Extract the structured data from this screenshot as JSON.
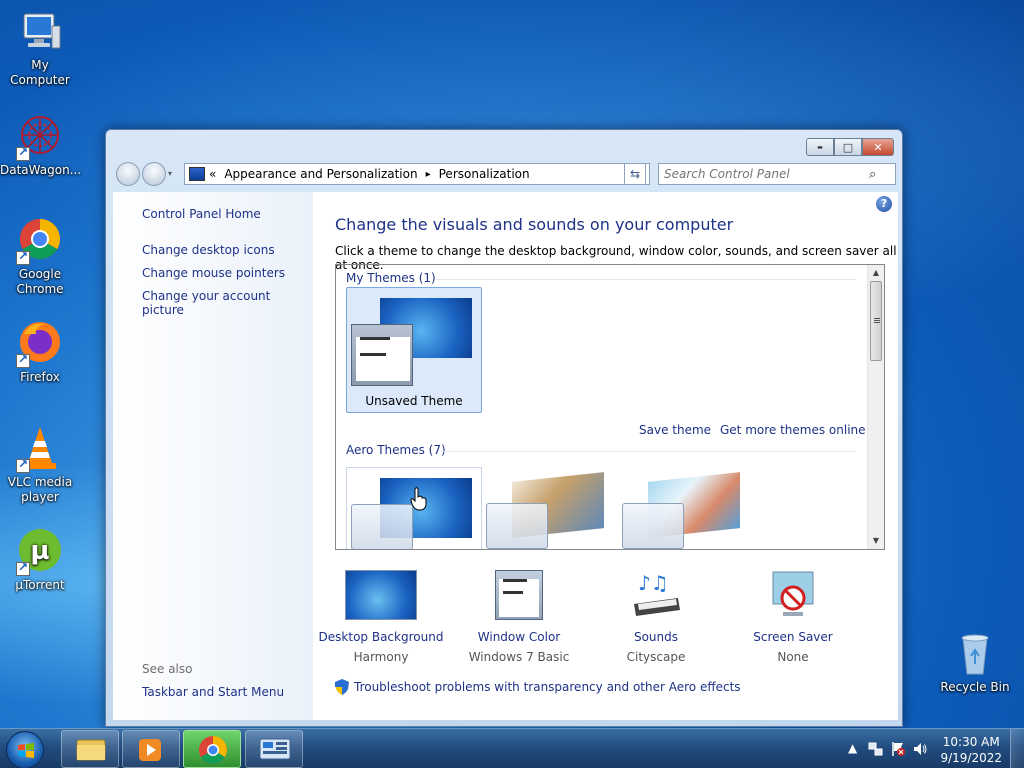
{
  "desktop": {
    "icons": [
      {
        "label": "My Computer"
      },
      {
        "label": "DataWagon..."
      },
      {
        "label": "Google Chrome"
      },
      {
        "label": "Firefox"
      },
      {
        "label": "VLC media player"
      },
      {
        "label": "µTorrent"
      },
      {
        "label": "Recycle Bin"
      }
    ]
  },
  "window": {
    "breadcrumb": {
      "overflow": "«",
      "items": [
        "Appearance and Personalization",
        "Personalization"
      ],
      "separator": "▸"
    },
    "search": {
      "placeholder": "Search Control Panel"
    },
    "controls": {
      "minimize": "▬",
      "maximize": "□",
      "close": "✕"
    },
    "left_pane": {
      "home": "Control Panel Home",
      "links": [
        "Change desktop icons",
        "Change mouse pointers",
        "Change your account picture"
      ],
      "see_also_label": "See also",
      "see_also_links": [
        "Taskbar and Start Menu"
      ]
    },
    "content": {
      "heading": "Change the visuals and sounds on your computer",
      "subheading": "Click a theme to change the desktop background, window color, sounds, and screen saver all at once.",
      "help": "?",
      "my_themes": {
        "label": "My Themes (1)",
        "items": [
          {
            "label": "Unsaved Theme",
            "selected": true
          }
        ],
        "save_link": "Save theme",
        "more_link": "Get more themes online"
      },
      "aero_themes": {
        "label": "Aero Themes (7)"
      },
      "bottom": [
        {
          "label": "Desktop Background",
          "value": "Harmony",
          "icon": "desktop-background-icon"
        },
        {
          "label": "Window Color",
          "value": "Windows 7 Basic",
          "icon": "window-color-icon"
        },
        {
          "label": "Sounds",
          "value": "Cityscape",
          "icon": "sounds-icon"
        },
        {
          "label": "Screen Saver",
          "value": "None",
          "icon": "screen-saver-icon"
        }
      ],
      "troubleshoot": "Troubleshoot problems with transparency and other Aero effects"
    }
  },
  "taskbar": {
    "clock_time": "10:30 AM",
    "clock_date": "9/19/2022",
    "tray_arrow": "▲"
  }
}
